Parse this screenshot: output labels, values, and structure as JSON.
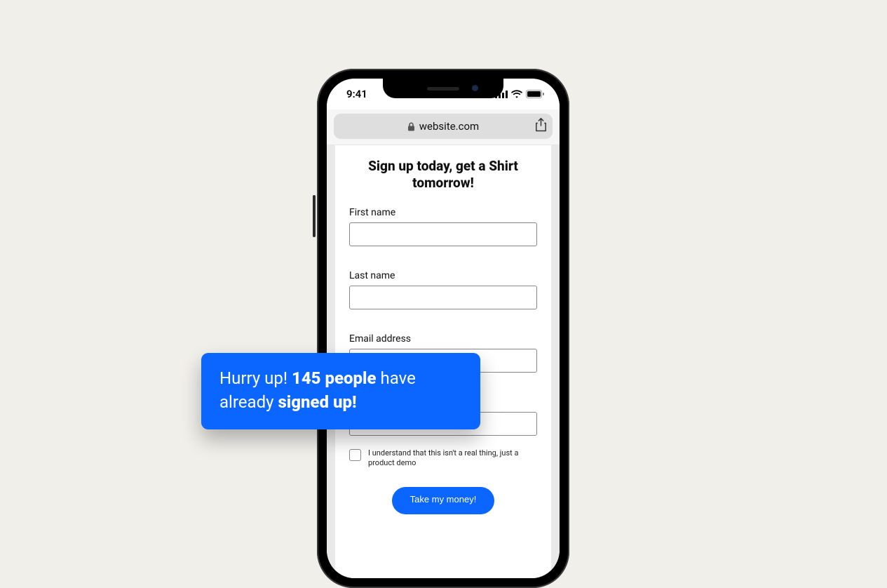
{
  "status": {
    "time": "9:41"
  },
  "browser": {
    "domain": "website.com"
  },
  "form": {
    "heading": "Sign up today, get a Shirt tomorrow!",
    "first_name_label": "First name",
    "first_name_value": "",
    "last_name_label": "Last name",
    "last_name_value": "",
    "email_label": "Email address",
    "email_value": "",
    "field4_value": "",
    "consent_text": "I understand that this isn't a real thing, just a product demo",
    "submit_label": "Take my money!"
  },
  "banner": {
    "prefix": "Hurry up! ",
    "bold1": "145 people",
    "mid": " have already ",
    "bold2": "signed up!"
  }
}
